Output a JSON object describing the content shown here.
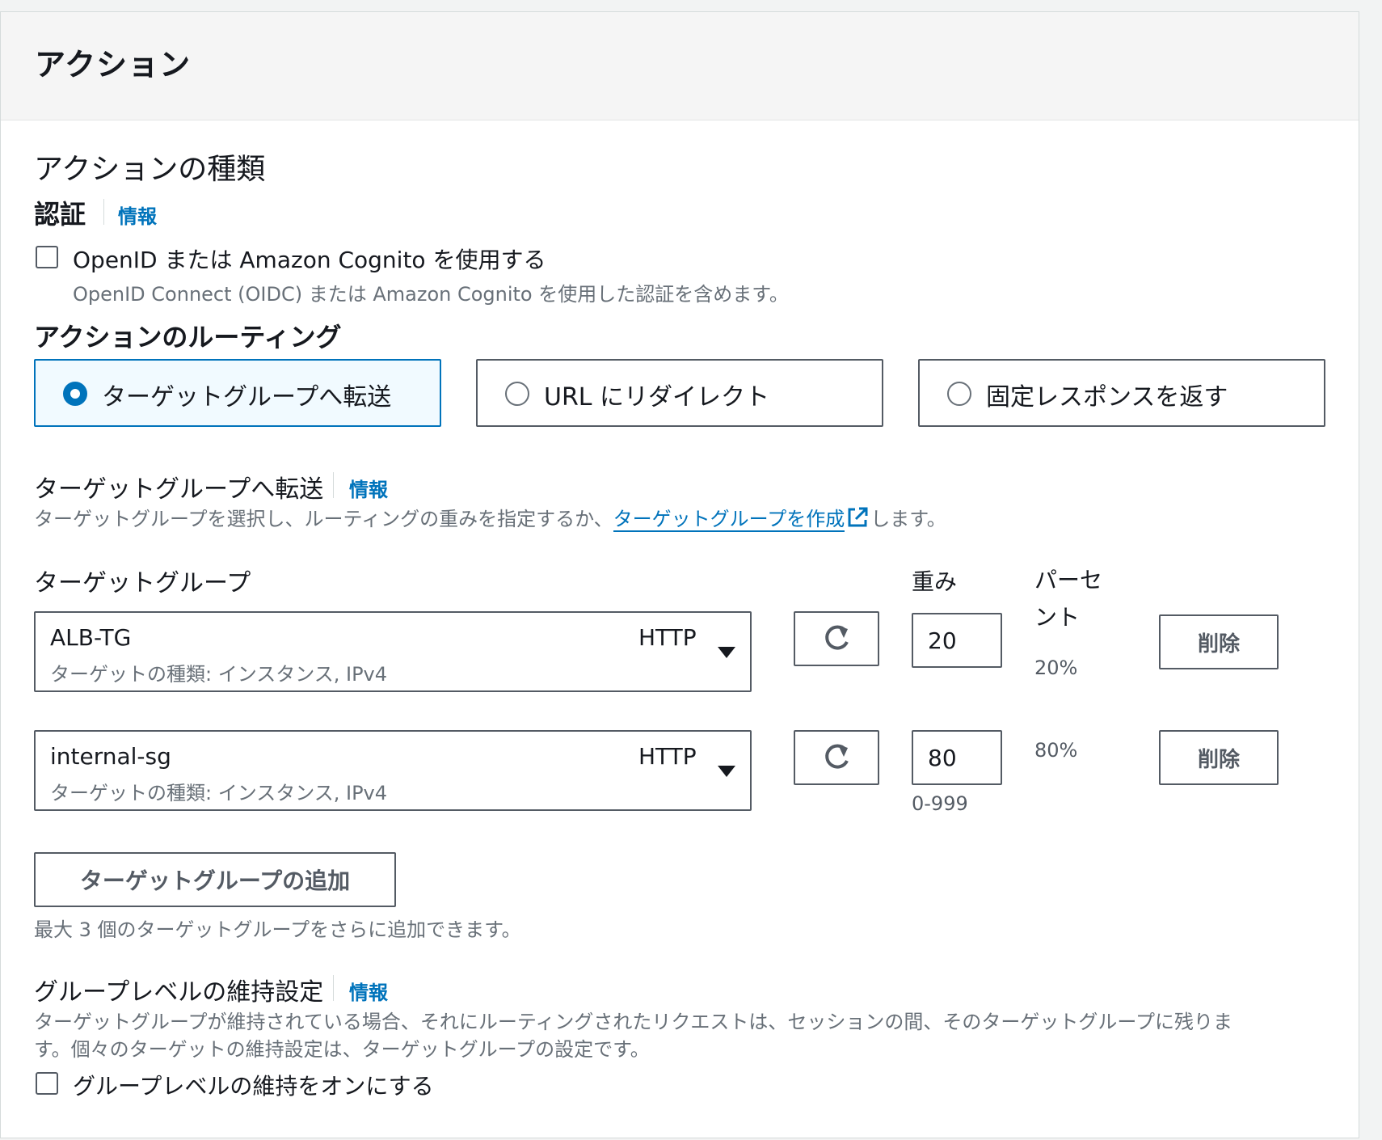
{
  "header": {
    "title": "アクション"
  },
  "action_type": {
    "heading": "アクションの種類",
    "auth": {
      "label": "認証",
      "info": "情報",
      "checkbox_label": "OpenID または Amazon Cognito を使用する",
      "checkbox_desc": "OpenID Connect (OIDC) または Amazon Cognito を使用した認証を含めます。",
      "checked": false
    }
  },
  "routing": {
    "heading": "アクションのルーティング",
    "options": [
      {
        "label": "ターゲットグループへ転送",
        "selected": true
      },
      {
        "label": "URL にリダイレクト",
        "selected": false
      },
      {
        "label": "固定レスポンスを返す",
        "selected": false
      }
    ]
  },
  "forward": {
    "title": "ターゲットグループへ転送",
    "info": "情報",
    "desc_prefix": "ターゲットグループを選択し、ルーティングの重みを指定するか、",
    "desc_link": "ターゲットグループを作成",
    "desc_suffix": "します。",
    "col_target": "ターゲットグループ",
    "col_weight": "重み",
    "col_percent_line1": "パーセ",
    "col_percent_line2": "ント",
    "rows": [
      {
        "name": "ALB-TG",
        "protocol": "HTTP",
        "meta": "ターゲットの種類: インスタンス, IPv4",
        "weight": "20",
        "percent": "20%",
        "delete": "削除"
      },
      {
        "name": "internal-sg",
        "protocol": "HTTP",
        "meta": "ターゲットの種類: インスタンス, IPv4",
        "weight": "80",
        "percent": "80%",
        "delete": "削除"
      }
    ],
    "weight_hint": "0-999",
    "add_button": "ターゲットグループの追加",
    "add_hint": "最大 3 個のターゲットグループをさらに追加できます。"
  },
  "stickiness": {
    "title": "グループレベルの維持設定",
    "info": "情報",
    "desc_line1": "ターゲットグループが維持されている場合、それにルーティングされたリクエストは、セッションの間、そのターゲットグループに残りま",
    "desc_line2": "す。個々のターゲットの維持設定は、ターゲットグループの設定です。",
    "checkbox_label": "グループレベルの維持をオンにする",
    "checked": false
  },
  "colors": {
    "accent": "#0073bb",
    "border": "#545b64",
    "muted": "#687078"
  }
}
